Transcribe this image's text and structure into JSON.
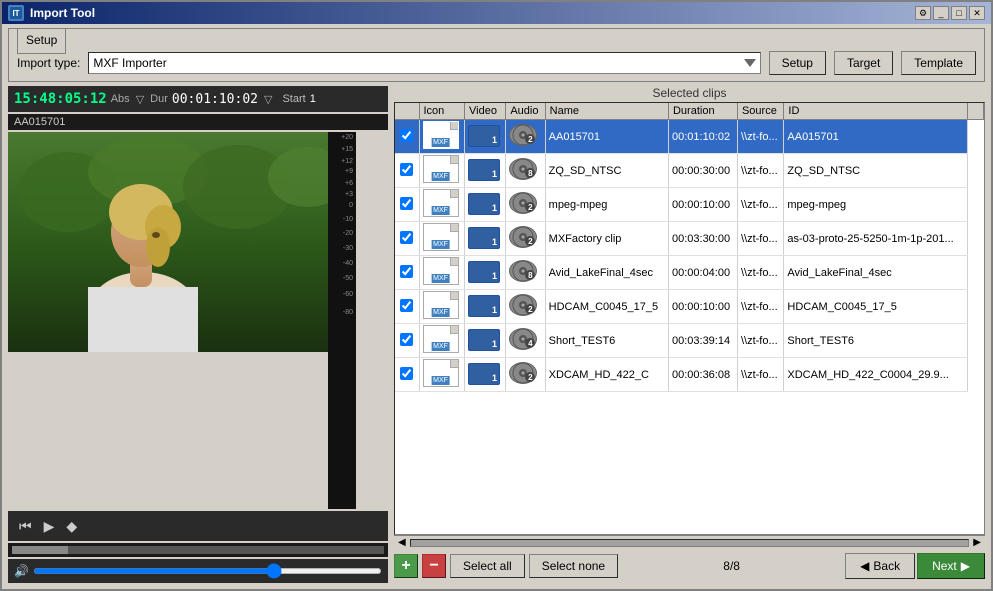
{
  "window": {
    "title": "Import Tool",
    "icon": "IT"
  },
  "setup": {
    "legend": "Setup",
    "import_type_label": "Import type:",
    "import_type_value": "MXF Importer",
    "buttons": {
      "setup": "Setup",
      "target": "Target",
      "template": "Template"
    }
  },
  "left_panel": {
    "clip_id": "AA015701",
    "timecode": "15:48:05:12",
    "timecode_mode": "Abs",
    "duration_label": "Dur",
    "duration": "00:01:10:02",
    "start_label": "Start",
    "start_value": "1"
  },
  "clips_table": {
    "header_label": "Selected clips",
    "columns": [
      "",
      "Icon",
      "Video",
      "Audio",
      "Name",
      "Duration",
      "Source",
      "ID"
    ],
    "rows": [
      {
        "checked": true,
        "name": "AA015701",
        "duration": "00:01:10:02",
        "source": "\\\\zt-fo...",
        "id": "AA015701",
        "video_num": "1",
        "audio_num": "2",
        "selected": true
      },
      {
        "checked": true,
        "name": "ZQ_SD_NTSC",
        "duration": "00:00:30:00",
        "source": "\\\\zt-fo...",
        "id": "ZQ_SD_NTSC",
        "video_num": "1",
        "audio_num": "8",
        "selected": false
      },
      {
        "checked": true,
        "name": "mpeg-mpeg",
        "duration": "00:00:10:00",
        "source": "\\\\zt-fo...",
        "id": "mpeg-mpeg",
        "video_num": "1",
        "audio_num": "2",
        "selected": false
      },
      {
        "checked": true,
        "name": "MXFactory clip",
        "duration": "00:03:30:00",
        "source": "\\\\zt-fo...",
        "id": "as-03-proto-25-5250-1m-1p-201...",
        "video_num": "1",
        "audio_num": "2",
        "selected": false
      },
      {
        "checked": true,
        "name": "Avid_LakeFinal_4sec",
        "duration": "00:00:04:00",
        "source": "\\\\zt-fo...",
        "id": "Avid_LakeFinal_4sec",
        "video_num": "1",
        "audio_num": "8",
        "selected": false
      },
      {
        "checked": true,
        "name": "HDCAM_C0045_17_5",
        "duration": "00:00:10:00",
        "source": "\\\\zt-fo...",
        "id": "HDCAM_C0045_17_5",
        "video_num": "1",
        "audio_num": "2",
        "selected": false
      },
      {
        "checked": true,
        "name": "Short_TEST6",
        "duration": "00:03:39:14",
        "source": "\\\\zt-fo...",
        "id": "Short_TEST6",
        "video_num": "1",
        "audio_num": "4",
        "selected": false
      },
      {
        "checked": true,
        "name": "XDCAM_HD_422_C",
        "duration": "00:00:36:08",
        "source": "\\\\zt-fo...",
        "id": "XDCAM_HD_422_C0004_29.9...",
        "video_num": "1",
        "audio_num": "2",
        "selected": false
      }
    ]
  },
  "bottom_bar": {
    "select_all": "Select all",
    "select_none": "Select none",
    "count": "8/8",
    "back": "Back",
    "next": "Next"
  },
  "level_ticks": [
    "+20",
    "+15",
    "+12",
    "+9",
    "+6",
    "+3",
    "0",
    "-10",
    "-20",
    "-30",
    "-40",
    "-50",
    "-60",
    "-80"
  ]
}
